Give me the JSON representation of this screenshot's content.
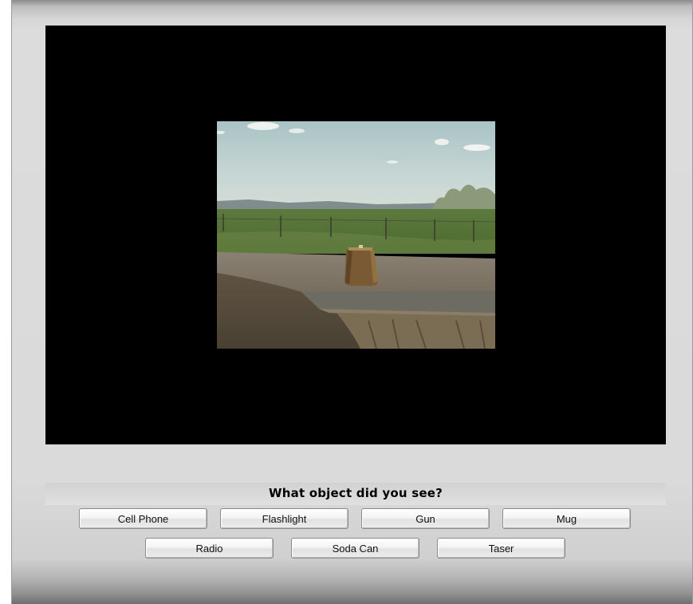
{
  "question": "What object did you see?",
  "buttons": {
    "row1": [
      "Cell Phone",
      "Flashlight",
      "Gun",
      "Mug"
    ],
    "row2": [
      "Radio",
      "Soda Can",
      "Taser"
    ]
  },
  "colors": {
    "stage_background": "#000000",
    "window_background": "#dcdcdc"
  }
}
